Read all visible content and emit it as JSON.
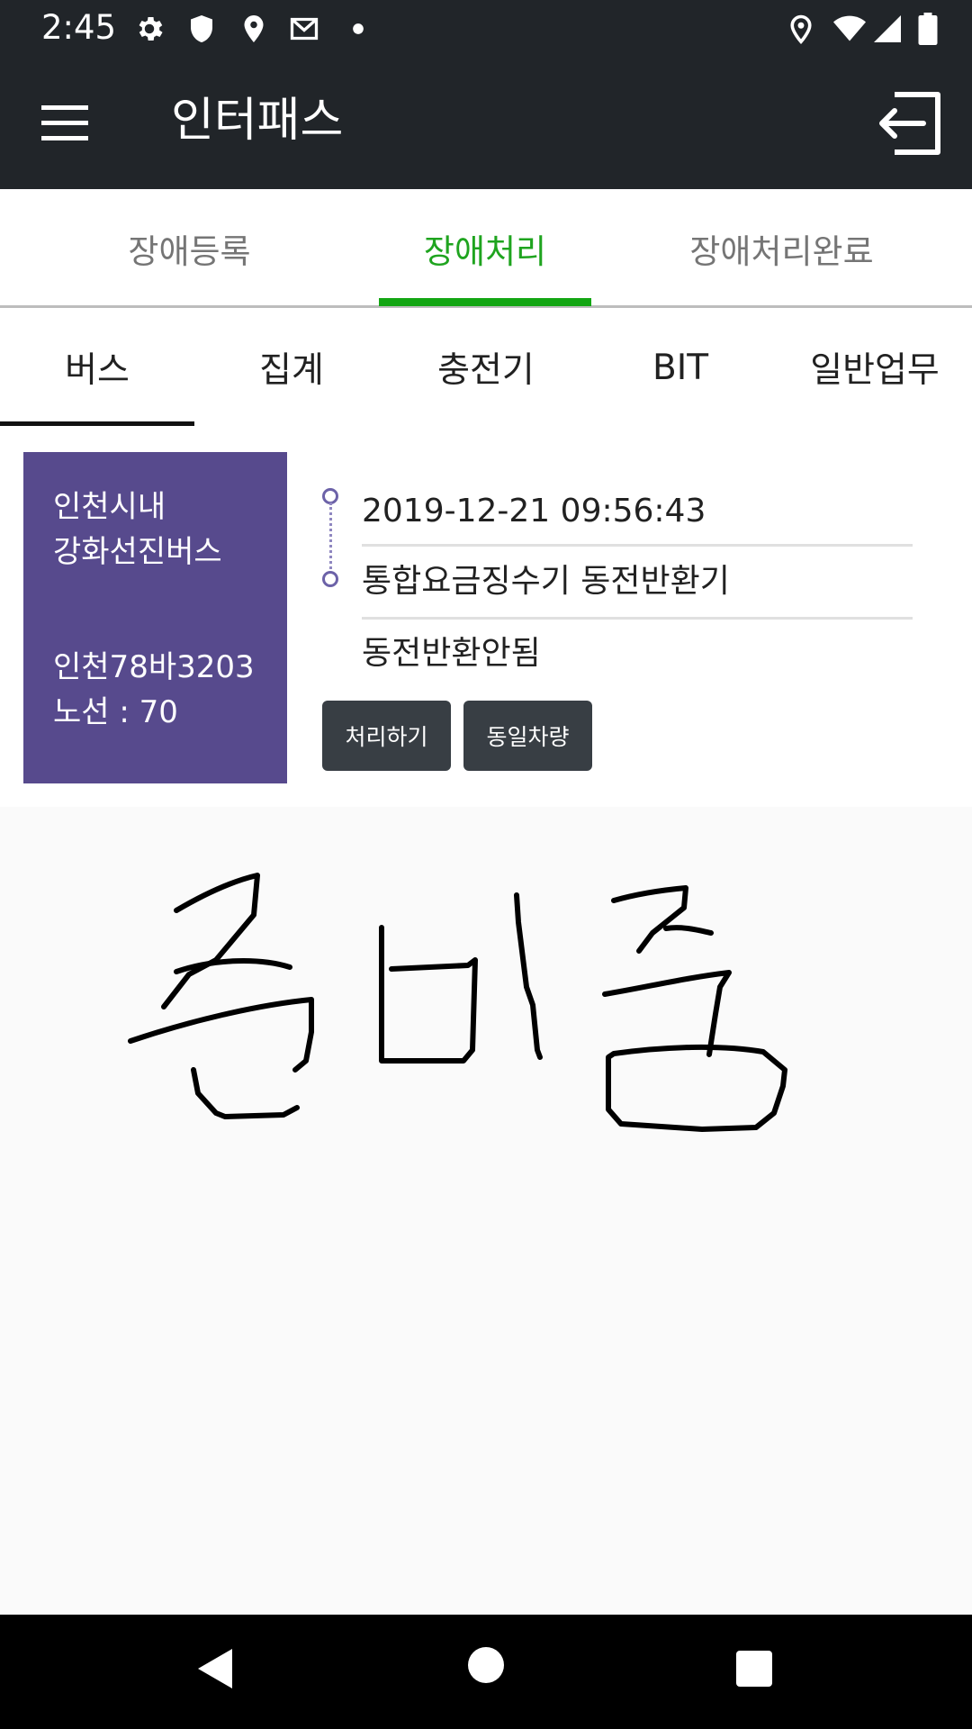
{
  "status_bar": {
    "time": "2:45",
    "left_icons": [
      "gear-icon",
      "shield-icon",
      "location-icon",
      "gmail-icon",
      "dot-icon"
    ],
    "right_icons": [
      "location-icon",
      "wifi-icon",
      "signal-icon",
      "battery-icon"
    ]
  },
  "app_bar": {
    "title": "인터패스",
    "menu_icon": "hamburger-menu-icon",
    "logout_icon": "logout-icon"
  },
  "primary_tabs": {
    "items": [
      {
        "label": "장애등록"
      },
      {
        "label": "장애처리"
      },
      {
        "label": "장애처리완료"
      }
    ],
    "active_index": 1,
    "active_color": "#1fa41f"
  },
  "secondary_tabs": {
    "items": [
      {
        "label": "버스"
      },
      {
        "label": "집계"
      },
      {
        "label": "충전기"
      },
      {
        "label": "BIT"
      },
      {
        "label": "일반업무"
      }
    ],
    "active_index": 0
  },
  "item": {
    "company_line1": "인천시내",
    "company_line2": "강화선진버스",
    "plate": "인천78바3203",
    "route": "노선 : 70",
    "datetime": "2019-12-21 09:56:43",
    "device": "통합요금징수기 동전반환기",
    "issue": "동전반환안됨",
    "process_button": "처리하기",
    "same_vehicle_button": "동일차량",
    "accent_color": "#574a8d"
  },
  "navigation_bar": {
    "icons": [
      "back-icon",
      "home-icon",
      "recents-icon"
    ]
  }
}
